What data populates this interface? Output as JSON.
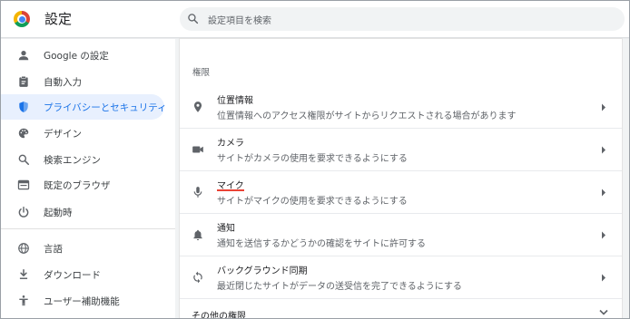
{
  "header": {
    "title": "設定",
    "search_placeholder": "設定項目を検索"
  },
  "sidebar": {
    "items": [
      {
        "label": "Google の設定",
        "icon": "person-icon"
      },
      {
        "label": "自動入力",
        "icon": "clipboard-icon"
      },
      {
        "label": "プライバシーとセキュリティ",
        "icon": "shield-icon",
        "active": true
      },
      {
        "label": "デザイン",
        "icon": "palette-icon"
      },
      {
        "label": "検索エンジン",
        "icon": "search-icon"
      },
      {
        "label": "既定のブラウザ",
        "icon": "browser-icon"
      },
      {
        "label": "起動時",
        "icon": "power-icon"
      },
      {
        "label": "言語",
        "icon": "globe-icon"
      },
      {
        "label": "ダウンロード",
        "icon": "download-icon"
      },
      {
        "label": "ユーザー補助機能",
        "icon": "accessibility-icon"
      }
    ]
  },
  "main": {
    "section_title": "権限",
    "rows": [
      {
        "title": "位置情報",
        "desc": "位置情報へのアクセス権限がサイトからリクエストされる場合があります",
        "icon": "location-icon"
      },
      {
        "title": "カメラ",
        "desc": "サイトがカメラの使用を要求できるようにする",
        "icon": "camera-icon"
      },
      {
        "title": "マイク",
        "desc": "サイトがマイクの使用を要求できるようにする",
        "icon": "microphone-icon"
      },
      {
        "title": "通知",
        "desc": "通知を送信するかどうかの確認をサイトに許可する",
        "icon": "bell-icon"
      },
      {
        "title": "バックグラウンド同期",
        "desc": "最近閉じたサイトがデータの送受信を完了できるようにする",
        "icon": "sync-icon"
      }
    ],
    "more_label": "その他の権限"
  },
  "colors": {
    "accent": "#1a73e8",
    "active_bg": "#e8f0fe",
    "highlight": "#ea4335"
  }
}
